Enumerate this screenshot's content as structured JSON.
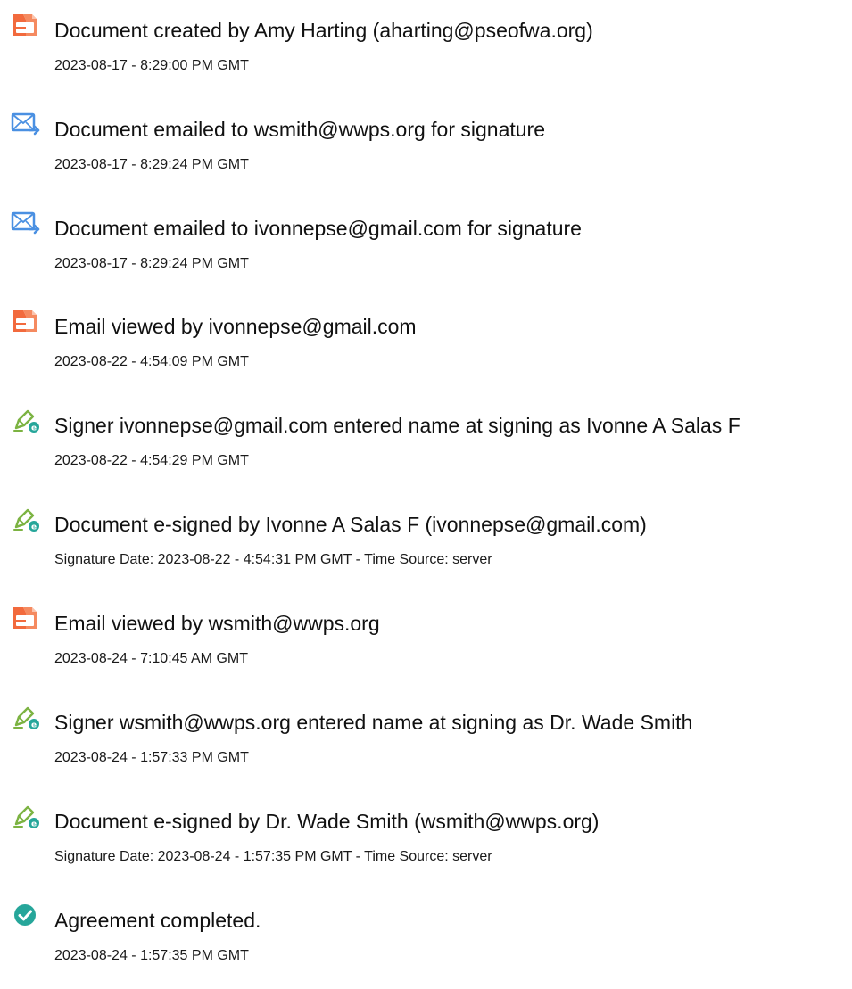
{
  "audit_log": {
    "events": [
      {
        "icon": "document-icon",
        "title": "Document created by Amy Harting (aharting@pseofwa.org)",
        "time": "2023-08-17 - 8:29:00 PM GMT"
      },
      {
        "icon": "email-sent-icon",
        "title": "Document emailed to wsmith@wwps.org for signature",
        "time": "2023-08-17 - 8:29:24 PM GMT"
      },
      {
        "icon": "email-sent-icon",
        "title": "Document emailed to ivonnepse@gmail.com for signature",
        "time": "2023-08-17 - 8:29:24 PM GMT"
      },
      {
        "icon": "document-icon",
        "title": "Email viewed by ivonnepse@gmail.com",
        "time": "2023-08-22 - 4:54:09 PM GMT"
      },
      {
        "icon": "e-sign-pen-icon",
        "title": "Signer ivonnepse@gmail.com entered name at signing as Ivonne A Salas F",
        "time": "2023-08-22 - 4:54:29 PM GMT"
      },
      {
        "icon": "e-sign-pen-icon",
        "title": "Document e-signed by Ivonne A Salas F (ivonnepse@gmail.com)",
        "time": "Signature Date: 2023-08-22 - 4:54:31 PM GMT - Time Source: server"
      },
      {
        "icon": "document-icon",
        "title": "Email viewed by wsmith@wwps.org",
        "time": "2023-08-24 - 7:10:45 AM GMT"
      },
      {
        "icon": "e-sign-pen-icon",
        "title": "Signer wsmith@wwps.org entered name at signing as Dr. Wade Smith",
        "time": "2023-08-24 - 1:57:33 PM GMT"
      },
      {
        "icon": "e-sign-pen-icon",
        "title": "Document e-signed by Dr. Wade Smith (wsmith@wwps.org)",
        "time": "Signature Date: 2023-08-24 - 1:57:35 PM GMT - Time Source: server"
      },
      {
        "icon": "checkmark-circle-icon",
        "title": "Agreement completed.",
        "time": "2023-08-24 - 1:57:35 PM GMT"
      }
    ]
  },
  "colors": {
    "document_icon": "#F26A3D",
    "email_icon": "#4A90E2",
    "sign_pen": "#7CB342",
    "sign_badge": "#26A69A",
    "check_circle": "#26A69A"
  }
}
